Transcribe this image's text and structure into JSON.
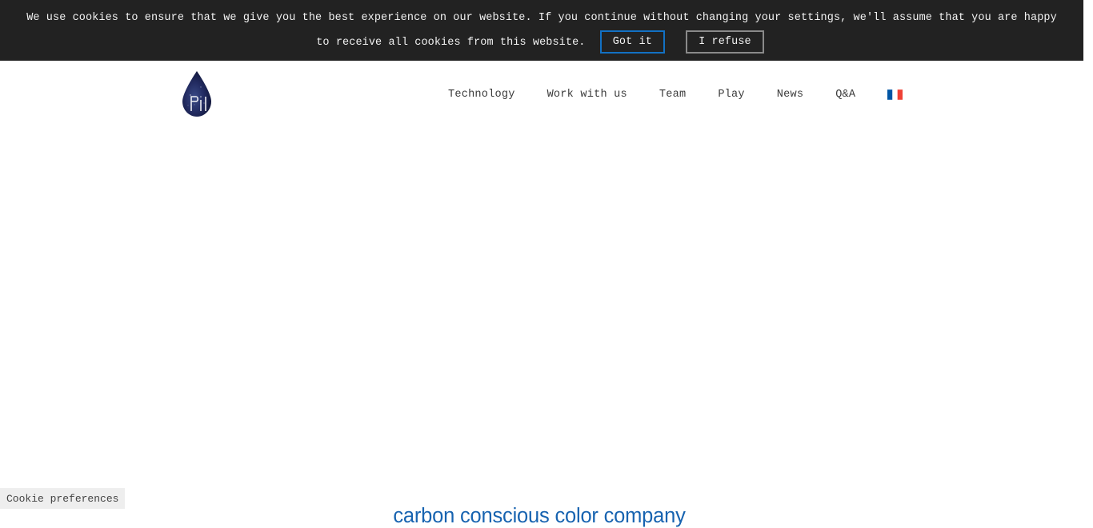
{
  "cookie_banner": {
    "message": "We use cookies to ensure that we give you the best experience on our website. If you continue without changing your settings, we'll assume that you are happy to receive all cookies from this website.",
    "accept_label": "Got it",
    "refuse_label": "I refuse",
    "background_color": "#222222",
    "text_color": "#f2f2f2",
    "accept_border_color": "#1271c4",
    "refuse_border_color": "#8a8a8a"
  },
  "header": {
    "logo": {
      "name": "pili-droplet-logo",
      "wordmark": "Pili",
      "color_dark": "#10163a",
      "color_mid": "#2b3470"
    },
    "nav": [
      {
        "label": "Technology"
      },
      {
        "label": "Work with us"
      },
      {
        "label": "Team"
      },
      {
        "label": "Play"
      },
      {
        "label": "News"
      },
      {
        "label": "Q&A"
      }
    ],
    "language": {
      "icon": "flag-fr-icon",
      "label": "FR",
      "colors": [
        "#0055a4",
        "#ffffff",
        "#ef4135"
      ]
    }
  },
  "main": {
    "headline": "carbon conscious color company",
    "headline_color": "#1763b0"
  },
  "cookie_preferences": {
    "label": "Cookie preferences",
    "background_color": "#eeeeee",
    "text_color": "#444444"
  }
}
